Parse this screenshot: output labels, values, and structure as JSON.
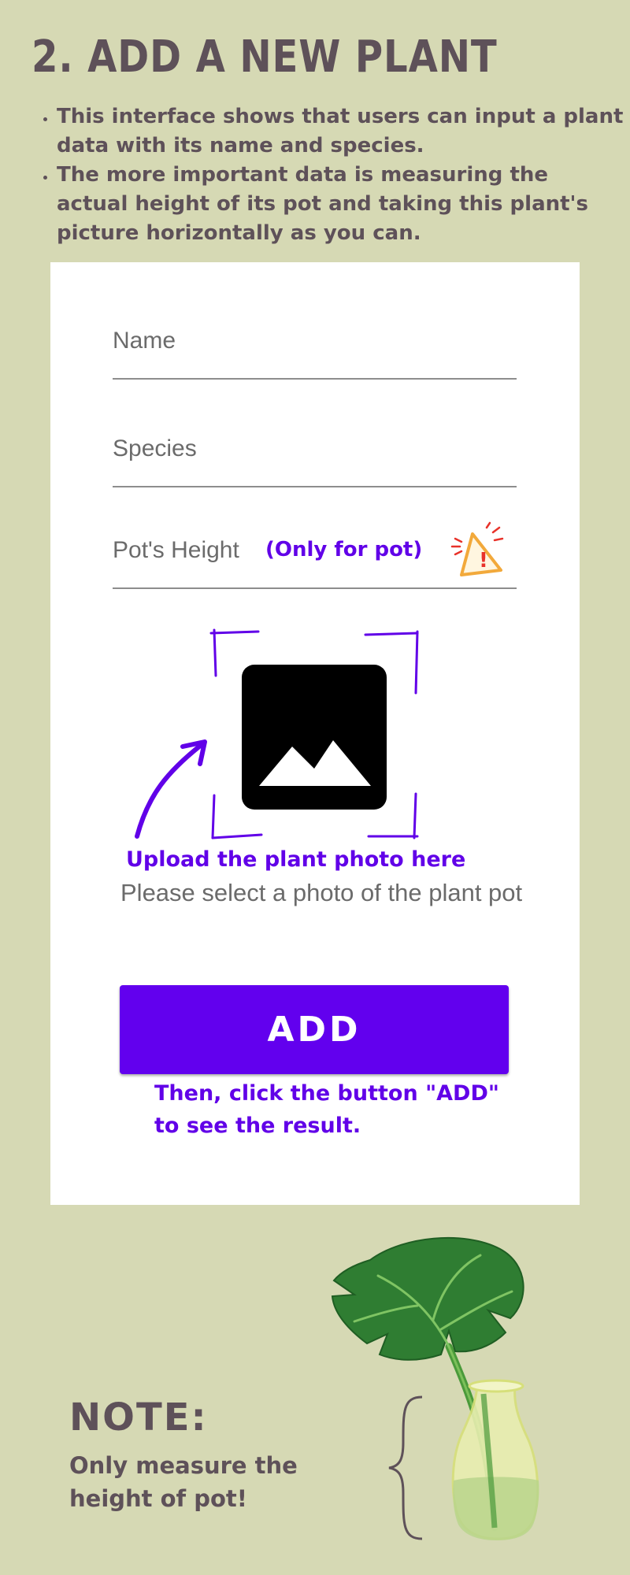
{
  "header": {
    "title": "2. ADD A NEW PLANT",
    "bullets": [
      "This interface shows that users can input a plant data with its name and species.",
      "The more important data is measuring the actual height of its pot and taking this plant's picture horizontally as you can."
    ]
  },
  "form": {
    "name_label": "Name",
    "species_label": "Species",
    "pot_height_label": "Pot's Height",
    "pot_note": "(Only for pot)",
    "upload_caption": "Upload the plant photo here",
    "photo_hint": "Please select a photo of the plant pot",
    "add_label": "ADD",
    "add_caption": "Then, click the button \"ADD\" to see the result."
  },
  "note": {
    "title": "NOTE:",
    "body": "Only measure the height of pot!"
  },
  "colors": {
    "background": "#d6d9b4",
    "accent_purple": "#6200ee",
    "heading_text": "#5e5159",
    "warning": "#f2a93b"
  },
  "icons": [
    "warning-icon",
    "image-placeholder-icon",
    "arrow-icon",
    "brace-icon",
    "plant-illustration"
  ]
}
